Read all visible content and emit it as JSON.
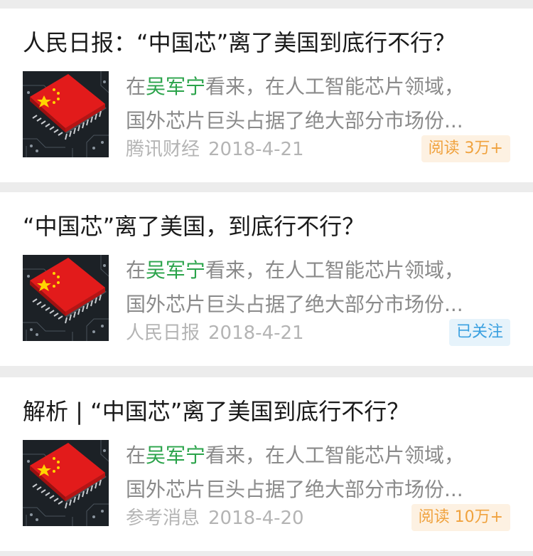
{
  "articles": [
    {
      "title": "人民日报：“中国芯”离了美国到底行不行？",
      "summary_pre": "在",
      "summary_highlight": "吴军宁",
      "summary_post": "看来，在人工智能芯片领域，",
      "summary_line2": "国外芯片巨头占据了绝大部分市场份...",
      "source": "腾讯财经",
      "date": "2018-4-21",
      "badge": "阅读 3万+",
      "badge_color": "#f0a23e",
      "thumbnail_icon": "china-flag-chip-image"
    },
    {
      "title": "“中国芯”离了美国，到底行不行？",
      "summary_pre": "在",
      "summary_highlight": "吴军宁",
      "summary_post": "看来，在人工智能芯片领域，",
      "summary_line2": "国外芯片巨头占据了绝大部分市场份...",
      "source": "人民日报",
      "date": "2018-4-21",
      "badge": "已关注",
      "badge_color": "#3aa0e0",
      "thumbnail_icon": "china-flag-chip-image"
    },
    {
      "title": "解析 | “中国芯”离了美国到底行不行？",
      "summary_pre": "在",
      "summary_highlight": "吴军宁",
      "summary_post": "看来，在人工智能芯片领域，",
      "summary_line2": "国外芯片巨头占据了绝大部分市场份...",
      "source": "参考消息",
      "date": "2018-4-20",
      "badge": "阅读 10万+",
      "badge_color": "#f0a23e",
      "thumbnail_icon": "china-flag-chip-image"
    }
  ],
  "colors": {
    "highlight": "#2aa34a",
    "title": "#1a1a1a",
    "summary": "#8a8a8a",
    "meta": "#b4b4b4",
    "separator": "#ececec"
  }
}
